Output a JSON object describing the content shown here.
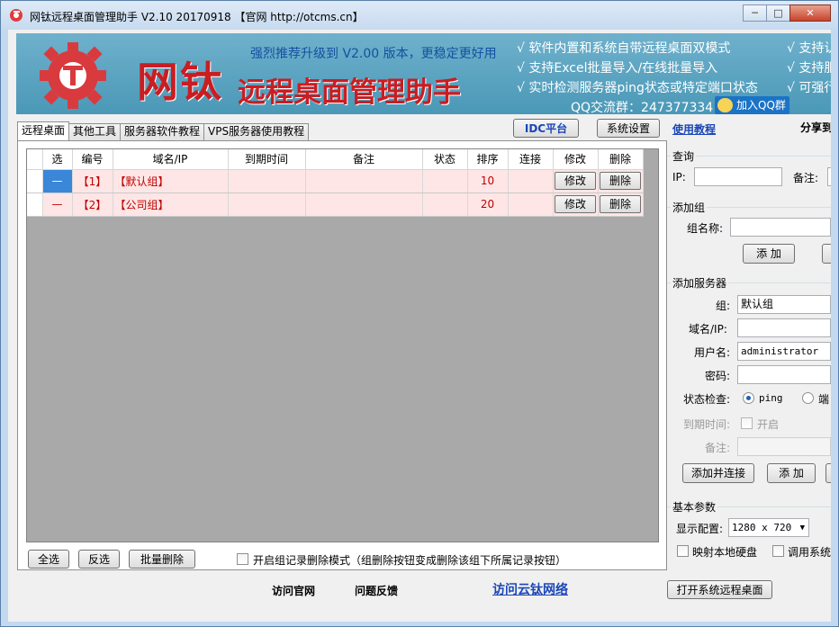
{
  "window": {
    "title": "网钛远程桌面管理助手 V2.10 20170918 【官网 http://otcms.cn】",
    "controls": {
      "minimize": "─",
      "maximize": "□",
      "close": "✕"
    }
  },
  "banner": {
    "brand_big": "网钛",
    "brand_sub": "远程桌面管理助手",
    "promo": "强烈推荐升级到 V2.00 版本，更稳定更好用",
    "features": [
      "√ 软件内置和系统自带远程桌面双模式",
      "√ 支持Excel批量导入/在线批量导入",
      "√ 实时检测服务器ping状态或特定端口状态"
    ],
    "features_right": [
      "√ 支持认",
      "√ 支持服",
      "√ 可强行"
    ],
    "qq_group": "QQ交流群：247377334",
    "qq_join": "加入QQ群"
  },
  "tabs": [
    {
      "label": "远程桌面",
      "active": true
    },
    {
      "label": "其他工具",
      "active": false
    },
    {
      "label": "服务器软件教程",
      "active": false
    },
    {
      "label": "VPS服务器使用教程",
      "active": false
    }
  ],
  "toolbar": {
    "idc": "IDC平台",
    "settings": "系统设置",
    "tutorial": "使用教程",
    "share": "分享到"
  },
  "grid": {
    "columns": [
      "选",
      "编号",
      "域名/IP",
      "到期时间",
      "备注",
      "状态",
      "排序",
      "连接",
      "修改",
      "删除"
    ],
    "rows": [
      {
        "sel": "—",
        "id": "【1】",
        "domain": "【默认组】",
        "expire": "",
        "note": "",
        "status": "",
        "order": "10",
        "connect": "",
        "edit": "修改",
        "delete": "删除"
      },
      {
        "sel": "—",
        "id": "【2】",
        "domain": "【公司组】",
        "expire": "",
        "note": "",
        "status": "",
        "order": "20",
        "connect": "",
        "edit": "修改",
        "delete": "删除"
      }
    ]
  },
  "bottom": {
    "select_all": "全选",
    "invert": "反选",
    "batch_delete": "批量删除",
    "group_delete_mode": "开启组记录删除模式（组删除按钮变成删除该组下所属记录按钮）"
  },
  "footer": {
    "official": "访问官网",
    "feedback": "问题反馈",
    "cloud": "访问云钛网络",
    "open_remote": "打开系统远程桌面"
  },
  "query": {
    "title": "查询",
    "ip_label": "IP:",
    "ip_value": "",
    "note_label": "备注:"
  },
  "add_group": {
    "title": "添加组",
    "name_label": "组名称:",
    "name_value": "",
    "add_btn": "添 加"
  },
  "add_server": {
    "title": "添加服务器",
    "group_label": "组:",
    "group_value": "默认组",
    "domain_label": "域名/IP:",
    "domain_value": "",
    "user_label": "用户名:",
    "user_value": "administrator",
    "password_label": "密码:",
    "password_value": "",
    "check_label": "状态检查:",
    "check_ping": "ping",
    "check_port": "端",
    "expire_label": "到期时间:",
    "expire_enable": "开启",
    "note_label": "备注:",
    "add_connect_btn": "添加并连接",
    "add_btn": "添 加"
  },
  "basic": {
    "title": "基本参数",
    "display_label": "显示配置:",
    "display_value": "1280 x 720",
    "map_disk": "映射本地硬盘",
    "use_system": "调用系统"
  },
  "colors": {
    "brand_red": "#c91d22",
    "banner_blue": "#4a98b7",
    "row_pink": "#ffe6e6",
    "link_blue": "#1a46b8"
  }
}
